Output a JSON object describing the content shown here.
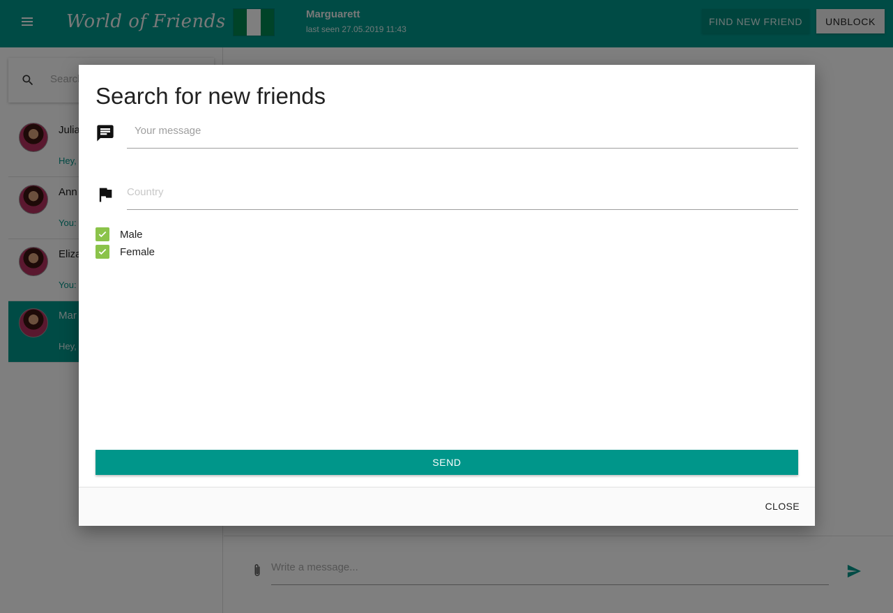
{
  "topbar": {
    "brand": "World of Friends",
    "contact_name": "Marguarett",
    "contact_last_seen": "last seen 27.05.2019 11:43",
    "find_button": "FIND NEW FRIEND",
    "unblock_button": "UNBLOCK",
    "flag_colors": [
      "#008751",
      "#ffffff",
      "#008751"
    ]
  },
  "sidebar": {
    "search_placeholder": "Search",
    "chats": [
      {
        "name": "Julia",
        "snippet": "Hey,"
      },
      {
        "name": "Ann",
        "snippet": "You:"
      },
      {
        "name": "Eliza",
        "snippet": "You:"
      },
      {
        "name": "Mar",
        "snippet": "Hey,"
      }
    ]
  },
  "composer": {
    "placeholder": "Write a message..."
  },
  "modal": {
    "title": "Search for new friends",
    "message_placeholder": "Your message",
    "country_placeholder": "Country",
    "checkboxes": [
      {
        "label": "Male",
        "checked": true
      },
      {
        "label": "Female",
        "checked": true
      }
    ],
    "send_button": "SEND",
    "close_button": "CLOSE"
  },
  "colors": {
    "primary": "#00968a",
    "checkbox": "#8bc34a"
  }
}
